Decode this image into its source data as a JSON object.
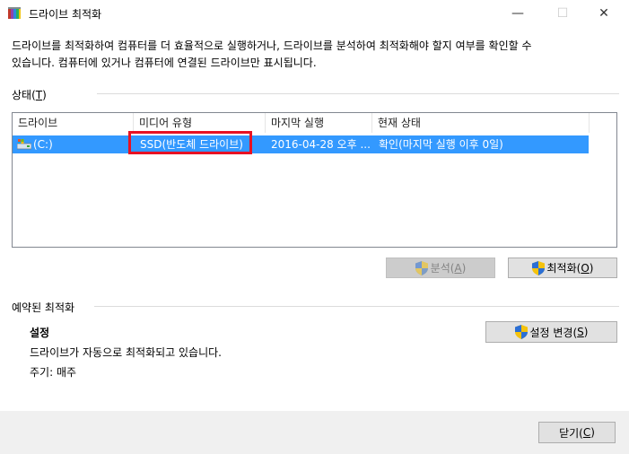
{
  "window": {
    "title": "드라이브 최적화",
    "minimize_glyph": "—",
    "maximize_glyph": "☐",
    "close_glyph": "✕"
  },
  "description": "드라이브를 최적화하여 컴퓨터를 더 효율적으로 실행하거나, 드라이브를 분석하여 최적화해야 할지 여부를 확인할 수\n있습니다. 컴퓨터에 있거나 컴퓨터에 연결된 드라이브만 표시됩니다.",
  "status_section": {
    "label": "상태(T)",
    "label_text": "상태(",
    "label_key": "T",
    "label_end": ")"
  },
  "drives_table": {
    "columns": [
      "드라이브",
      "미디어 유형",
      "마지막 실행",
      "현재 상태"
    ],
    "rows": [
      {
        "drive": "(C:)",
        "media_type": "SSD(반도체 드라이브)",
        "last_run": "2016-04-28 오후 ...",
        "status": "확인(마지막 실행 이후 0일)"
      }
    ]
  },
  "buttons": {
    "analyze": {
      "label": "분석(A)",
      "text": "분석(",
      "key": "A",
      "end": ")",
      "enabled": false
    },
    "optimize": {
      "label": "최적화(O)",
      "text": "최적화(",
      "key": "O",
      "end": ")",
      "enabled": true
    },
    "change_settings": {
      "label": "설정 변경(S)",
      "text": "설정 변경(",
      "key": "S",
      "end": ")"
    },
    "close": {
      "label": "닫기(C)",
      "text": "닫기(",
      "key": "C",
      "end": ")"
    }
  },
  "scheduled": {
    "section_label": "예약된 최적화",
    "settings_heading": "설정",
    "auto_text": "드라이브가 자동으로 최적화되고 있습니다.",
    "frequency": "주기: 매주"
  },
  "colors": {
    "selection": "#3399ff",
    "highlight_box": "#e81123",
    "footer_bg": "#f0f0f0"
  },
  "icons": [
    "defrag-app-icon",
    "drive-icon",
    "uac-shield-icon"
  ]
}
